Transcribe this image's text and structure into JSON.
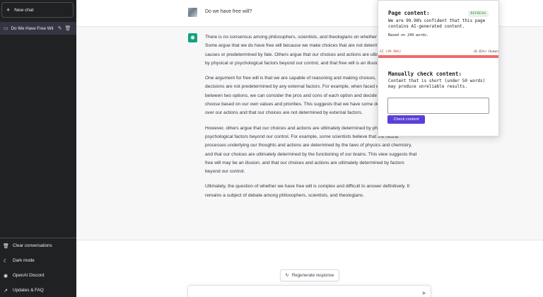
{
  "sidebar": {
    "new_chat": "New chat",
    "conversation_title": "Do We Have Free Wil",
    "bottom_items": [
      {
        "label": "Clear conversations",
        "icon": "trash-icon"
      },
      {
        "label": "Dark mode",
        "icon": "moon-icon"
      },
      {
        "label": "OpenAI Discord",
        "icon": "discord-icon"
      },
      {
        "label": "Updates & FAQ",
        "icon": "external-link-icon"
      }
    ]
  },
  "chat": {
    "question": "Do we have free will?",
    "answer": [
      "There is no consensus among philosophers, scientists, and theologians on whether we have free will. Some argue that we do have free will because we make choices that are not determined by prior causes or predetermined by fate. Others argue that our choices and actions are ultimately determined by physical or psychological factors beyond our control, and that free will is an illusion.",
      "One argument for free will is that we are capable of reasoning and making choices, and that these decisions are not predetermined by any external factors. For example, when faced with a choice between two options, we can consider the pros and cons of each option and decide which one to choose based on our own values and priorities. This suggests that we have some degree of control over our actions and that our choices are not determined by external factors.",
      "However, others argue that our choices and actions are ultimately determined by physical or psychological factors beyond our control. For example, some scientists believe that the neural processes underlying our thoughts and actions are determined by the laws of physics and chemistry, and that our choices are ultimately determined by the functioning of our brains. This view suggests that free will may be an illusion, and that our choices and actions are ultimately determined by factors beyond our control.",
      "Ultimately, the question of whether we have free will is complex and difficult to answer definitively. It remains a subject of debate among philosophers, scientists, and theologians."
    ],
    "regenerate": "Regenerate response"
  },
  "detector": {
    "title": "Page content:",
    "refresh": "REFRESH",
    "description": "We are 99.98% confident that this page contains AI-generated content.",
    "words": "Based on 244 words.",
    "ai_label": "AI (99.98%)",
    "human_label": "(0.02%) Human",
    "ai_fraction": 0.9998,
    "manual_title": "Manually check content:",
    "manual_desc": "Content that is short (under 50 words) may produce unreliable results.",
    "check_button": "Check content",
    "colors": {
      "ai": "#ef6b6b",
      "human": "#4caf50",
      "button": "#5c3fd6"
    }
  }
}
